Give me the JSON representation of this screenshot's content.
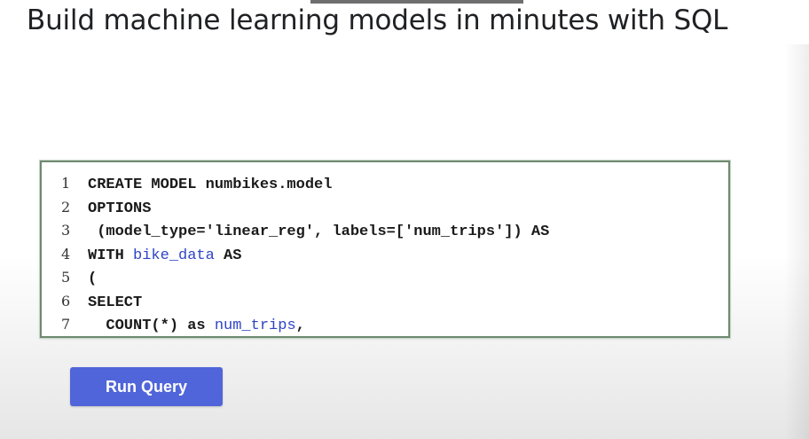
{
  "header": {
    "title": "Build machine learning models in minutes with SQL"
  },
  "code": {
    "lines": [
      {
        "num": "1",
        "parts": [
          {
            "text": "CREATE MODEL numbikes.model",
            "kind": "keyword"
          }
        ]
      },
      {
        "num": "2",
        "parts": [
          {
            "text": "OPTIONS",
            "kind": "keyword"
          }
        ]
      },
      {
        "num": "3",
        "parts": [
          {
            "text": " (model_type='linear_reg', labels=['num_trips']) AS",
            "kind": "keyword"
          }
        ]
      },
      {
        "num": "4",
        "parts": [
          {
            "text": "WITH ",
            "kind": "keyword"
          },
          {
            "text": "bike_data",
            "kind": "identifier"
          },
          {
            "text": " AS",
            "kind": "keyword"
          }
        ]
      },
      {
        "num": "5",
        "parts": [
          {
            "text": "(",
            "kind": "keyword"
          }
        ]
      },
      {
        "num": "6",
        "parts": [
          {
            "text": "SELECT",
            "kind": "keyword"
          }
        ]
      },
      {
        "num": "7",
        "parts": [
          {
            "text": "  COUNT(*) as ",
            "kind": "keyword"
          },
          {
            "text": "num_trips",
            "kind": "identifier"
          },
          {
            "text": ",",
            "kind": "keyword"
          }
        ]
      }
    ]
  },
  "actions": {
    "run_query_label": "Run Query"
  },
  "colors": {
    "button_bg": "#5065d9",
    "button_text": "#ffffff",
    "identifier": "#2f45c4",
    "code_border": "#6e8a70",
    "headline_text": "#202124"
  }
}
